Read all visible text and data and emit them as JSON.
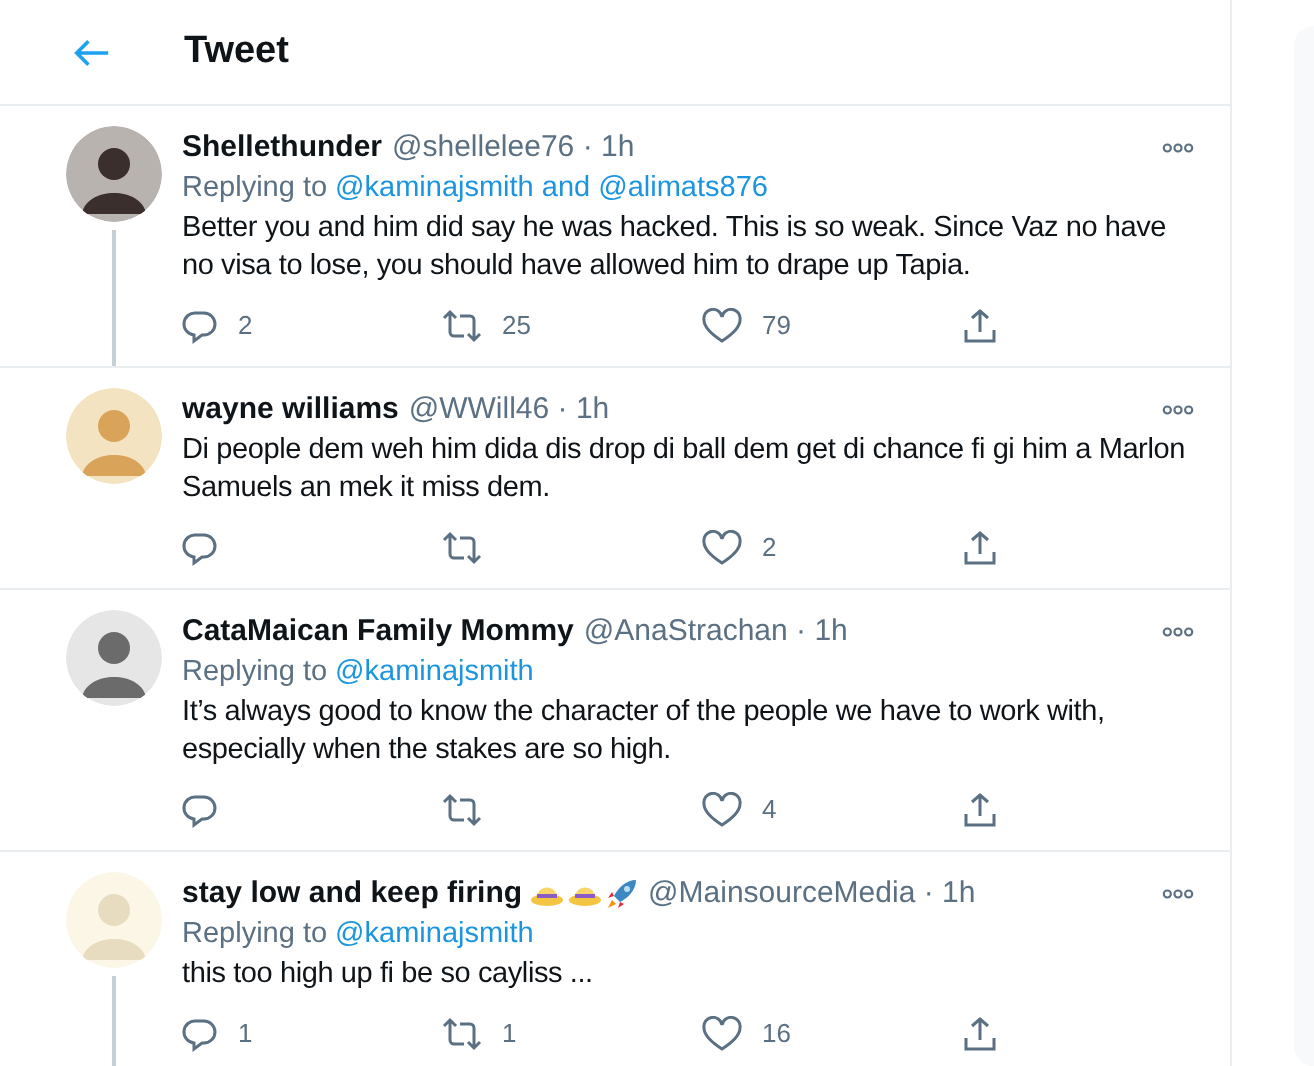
{
  "header": {
    "title": "Tweet"
  },
  "tweets": [
    {
      "name": "Shellethunder",
      "handle": "@shellelee76",
      "separator": "·",
      "time": "1h",
      "thread_line": true,
      "replying": {
        "label": "Replying to",
        "targets": "@kaminajsmith and @alimats876"
      },
      "text": "Better you and him did say he was hacked. This is so weak. Since Vaz no have no visa to lose, you should have allowed him to drape up Tapia.",
      "replies": "2",
      "retweets": "25",
      "likes": "79"
    },
    {
      "name": "wayne williams",
      "handle": "@WWill46",
      "separator": "·",
      "time": "1h",
      "thread_line": false,
      "text": "Di people dem weh him dida dis drop di ball dem get di chance fi gi him a Marlon Samuels an mek it miss dem.",
      "likes": "2"
    },
    {
      "name": "CataMaican Family Mommy",
      "handle": "@AnaStrachan",
      "separator": "·",
      "time": "1h",
      "thread_line": false,
      "replying": {
        "label": "Replying to",
        "targets": "@kaminajsmith"
      },
      "text": "It’s always good to know the character of the people we have to work with, especially when the stakes are so high.",
      "likes": "4"
    },
    {
      "name": "stay low and keep firing",
      "name_emoji": [
        {
          "kind": "hat"
        },
        {
          "kind": "hat"
        },
        {
          "kind": "rocket"
        }
      ],
      "handle": "@MainsourceMedia",
      "separator": "·",
      "time": "1h",
      "thread_line": true,
      "replying": {
        "label": "Replying to",
        "targets": "@kaminajsmith"
      },
      "text": "this too high up fi be so cayliss ...",
      "replies": "1",
      "retweets": "1",
      "likes": "16"
    }
  ]
}
